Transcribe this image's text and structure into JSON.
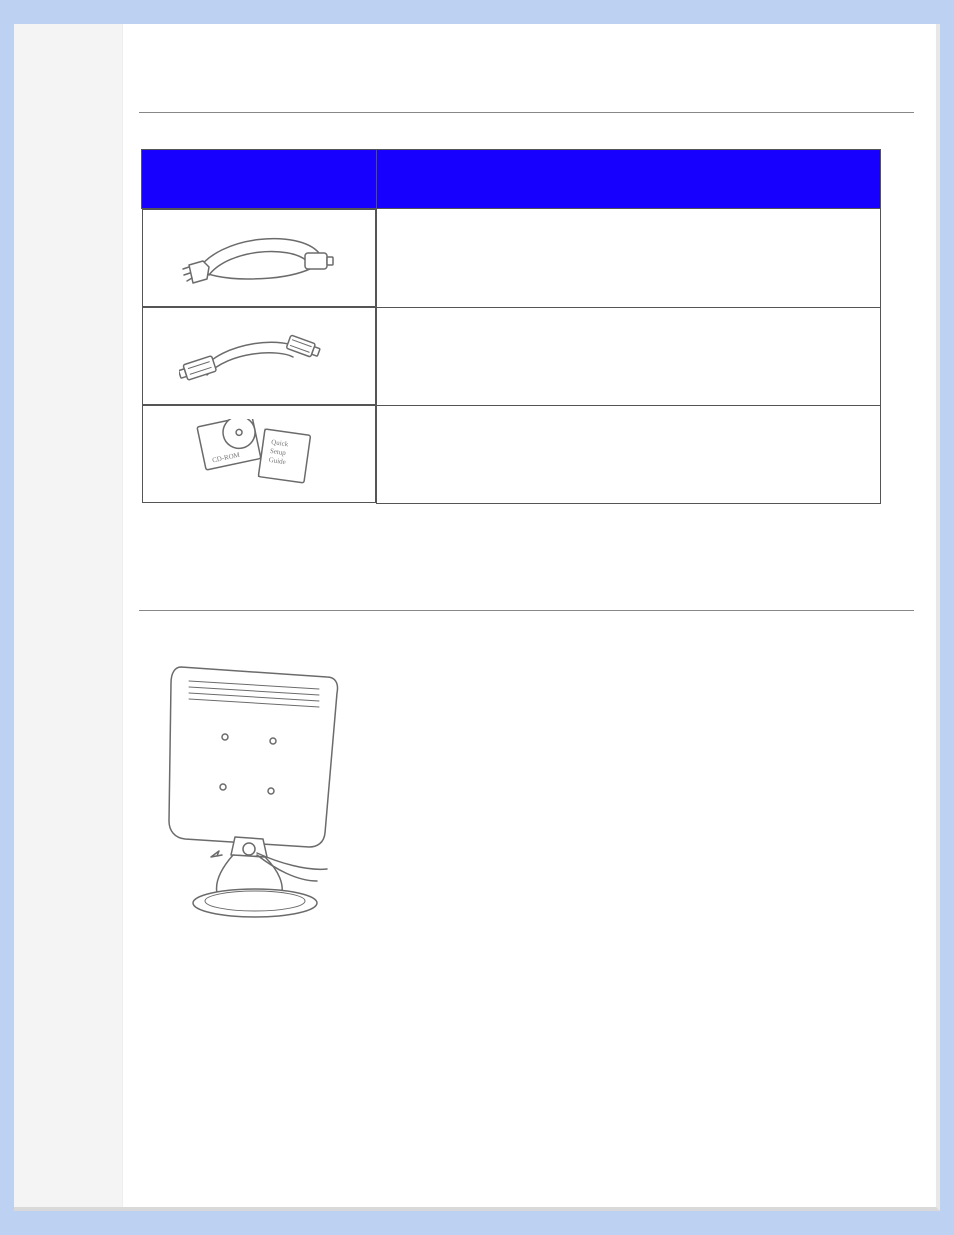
{
  "table": {
    "header_col1": "",
    "header_col2": "",
    "rows": [
      {
        "illustration": "power-cord-icon",
        "desc": ""
      },
      {
        "illustration": "signal-cable-icon",
        "desc": ""
      },
      {
        "illustration": "cd-and-guide-icon",
        "desc": "",
        "cd_label": "CD-ROM",
        "guide_line1": "Quick",
        "guide_line2": "Setup",
        "guide_line3": "Guide"
      }
    ]
  }
}
